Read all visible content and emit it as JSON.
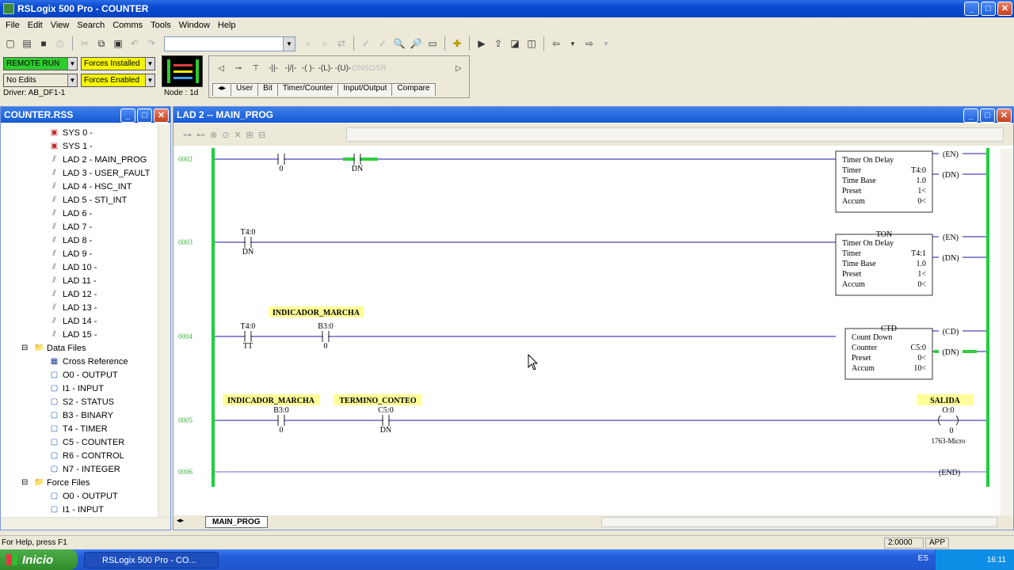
{
  "window": {
    "title": "RSLogix 500 Pro - COUNTER"
  },
  "menu": [
    "File",
    "Edit",
    "View",
    "Search",
    "Comms",
    "Tools",
    "Window",
    "Help"
  ],
  "status": {
    "mode": "REMOTE RUN",
    "forces_installed": "Forces Installed",
    "edits": "No Edits",
    "forces_enabled": "Forces Enabled",
    "driver": "Driver: AB_DF1-1",
    "node": "Node : 1d"
  },
  "instruction_tabs": [
    "User",
    "Bit",
    "Timer/Counter",
    "Input/Output",
    "Compare"
  ],
  "colors": {
    "run": "#2ecc2e",
    "forces": "#f4f400",
    "rail": "#1fcf3c",
    "tag": "#ffff99"
  },
  "project": {
    "title": "COUNTER.RSS",
    "items": [
      {
        "label": "SYS 0 -",
        "icon": "program-file-icon"
      },
      {
        "label": "SYS 1 -",
        "icon": "program-file-icon"
      },
      {
        "label": "LAD 2 - MAIN_PROG",
        "icon": "ladder-icon"
      },
      {
        "label": "LAD 3 - USER_FAULT",
        "icon": "ladder-icon"
      },
      {
        "label": "LAD 4 - HSC_INT",
        "icon": "ladder-icon"
      },
      {
        "label": "LAD 5 - STI_INT",
        "icon": "ladder-icon"
      },
      {
        "label": "LAD 6 -",
        "icon": "ladder-icon"
      },
      {
        "label": "LAD 7 -",
        "icon": "ladder-icon"
      },
      {
        "label": "LAD 8 -",
        "icon": "ladder-icon"
      },
      {
        "label": "LAD 9 -",
        "icon": "ladder-icon"
      },
      {
        "label": "LAD 10 -",
        "icon": "ladder-icon"
      },
      {
        "label": "LAD 11 -",
        "icon": "ladder-icon"
      },
      {
        "label": "LAD 12 -",
        "icon": "ladder-icon"
      },
      {
        "label": "LAD 13 -",
        "icon": "ladder-icon"
      },
      {
        "label": "LAD 14 -",
        "icon": "ladder-icon"
      },
      {
        "label": "LAD 15 -",
        "icon": "ladder-icon"
      },
      {
        "label": "Data Files",
        "icon": "folder-icon"
      },
      {
        "label": "Cross Reference",
        "icon": "cross-reference-icon"
      },
      {
        "label": "O0 - OUTPUT",
        "icon": "data-file-icon"
      },
      {
        "label": "I1 - INPUT",
        "icon": "data-file-icon"
      },
      {
        "label": "S2 - STATUS",
        "icon": "data-file-icon"
      },
      {
        "label": "B3 - BINARY",
        "icon": "data-file-icon"
      },
      {
        "label": "T4 - TIMER",
        "icon": "data-file-icon"
      },
      {
        "label": "C5 - COUNTER",
        "icon": "data-file-icon"
      },
      {
        "label": "R6 - CONTROL",
        "icon": "data-file-icon"
      },
      {
        "label": "N7 - INTEGER",
        "icon": "data-file-icon"
      },
      {
        "label": "Force Files",
        "icon": "folder-icon"
      },
      {
        "label": "O0 - OUTPUT",
        "icon": "data-file-icon"
      },
      {
        "label": "I1 - INPUT",
        "icon": "data-file-icon"
      }
    ]
  },
  "ladder": {
    "title": "LAD 2 -- MAIN_PROG",
    "file_tab": "MAIN_PROG",
    "rungs": [
      {
        "number": "0002",
        "contacts": [
          {
            "addr": "",
            "bit": "0"
          },
          {
            "addr": "",
            "bit": "DN"
          }
        ],
        "box": {
          "header": "",
          "lines": [
            [
              "Timer On Delay",
              ""
            ],
            [
              "Timer",
              "T4:0"
            ],
            [
              "Time Base",
              "1.0"
            ],
            [
              "Preset",
              "1<"
            ],
            [
              "Accum",
              "0<"
            ]
          ]
        },
        "coils": [
          "EN",
          "DN"
        ]
      },
      {
        "number": "0003",
        "contacts": [
          {
            "addr": "T4:0",
            "bit": "DN"
          }
        ],
        "box": {
          "header": "TON",
          "lines": [
            [
              "Timer On Delay",
              ""
            ],
            [
              "Timer",
              "T4:1"
            ],
            [
              "Time Base",
              "1.0"
            ],
            [
              "Preset",
              "1<"
            ],
            [
              "Accum",
              "0<"
            ]
          ]
        },
        "coils": [
          "EN",
          "DN"
        ]
      },
      {
        "number": "0004",
        "tag": "INDICADOR_MARCHA",
        "contacts": [
          {
            "addr": "T4:0",
            "bit": "TT"
          },
          {
            "addr": "B3:0",
            "bit": "0"
          }
        ],
        "box": {
          "header": "CTD",
          "lines": [
            [
              "Count Down",
              ""
            ],
            [
              "Counter",
              "C5:0"
            ],
            [
              "Preset",
              "0<"
            ],
            [
              "Accum",
              "10<"
            ]
          ]
        },
        "coils": [
          "CD",
          "DN"
        ]
      },
      {
        "number": "0005",
        "tags": [
          "INDICADOR_MARCHA",
          "TERMINO_CONTEO",
          "SALIDA"
        ],
        "contacts": [
          {
            "addr": "B3:0",
            "bit": "0"
          },
          {
            "addr": "C5:0",
            "bit": "DN"
          }
        ],
        "output": {
          "addr": "O:0",
          "bit": "0",
          "device": "1763-Micro"
        }
      },
      {
        "number": "0006",
        "end": "END"
      }
    ]
  },
  "statusbar": {
    "help": "For Help, press F1",
    "position": "2:0000",
    "mode": "APP"
  },
  "taskbar": {
    "start": "Inicio",
    "task": "RSLogix 500 Pro - CO...",
    "lang": "ES",
    "time": "16:11"
  }
}
